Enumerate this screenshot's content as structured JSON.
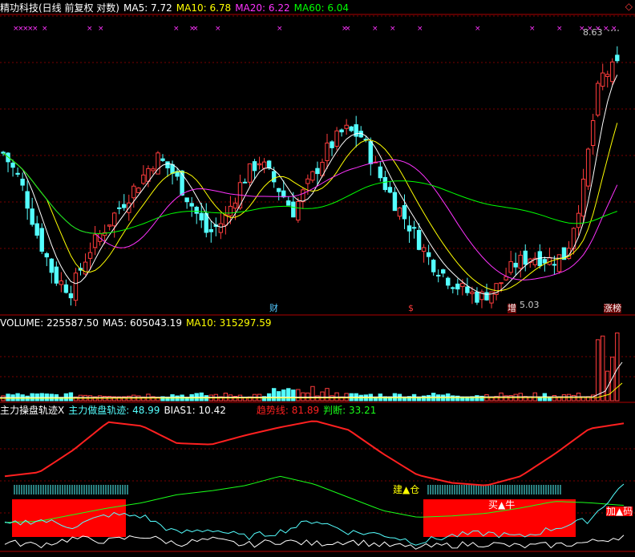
{
  "colors": {
    "up": "#ff3c3c",
    "down": "#54ffff",
    "ma5": "#ffffff",
    "ma10": "#ffff00",
    "ma20": "#ff33ff",
    "ma60": "#00ff00",
    "volume": "#ffffff",
    "trend": "#ff2020",
    "judge": "#19ff19",
    "main": "#54ffff",
    "bias": "#ffffff",
    "red_box": "#ff0000",
    "grid": "#7a0000"
  },
  "header": {
    "stock_name": "精功科技(日线 前复权 对数)",
    "ma5": "MA5: 7.72",
    "ma10": "MA10: 6.78",
    "ma20": "MA20: 6.22",
    "ma60": "MA60: 6.04",
    "corner_icon": "diamond-icon"
  },
  "price_panel": {
    "high_label": "8.63",
    "low_label": "5.03",
    "event_markers": [
      {
        "text": "财",
        "color": "#54c8ff"
      },
      {
        "text": "$",
        "color": "#ff3c3c"
      },
      {
        "text": "增",
        "color": "#ffffff"
      },
      {
        "text": "涨榜",
        "color": "#ffffff"
      }
    ]
  },
  "volume_panel": {
    "volume": "VOLUME: 225587.50",
    "ma5": "MA5: 605043.19",
    "ma10": "MA10: 315297.59"
  },
  "indicator_panel": {
    "title": "主力操盘轨迹X",
    "main_track": "主力做盘轨迹: 48.99",
    "bias1": "BIAS1: 10.42",
    "trend_line": "趋势线: 81.89",
    "judge": "判断: 33.21",
    "signal_build": "建▲仓",
    "signal_buy": "买▲牛",
    "signal_add": "加▲码"
  },
  "chart_data": [
    {
      "type": "candlestick",
      "title": "精功科技(日线 前复权 对数)",
      "scale": "log",
      "series_names": [
        "MA5",
        "MA10",
        "MA20",
        "MA60"
      ],
      "ylim": [
        4.9,
        9.2
      ],
      "y_ticks": [
        8.63,
        5.03
      ],
      "grid": "dotted horizontal",
      "annotations": [
        "8.63",
        "5.03",
        "财",
        "$",
        "增",
        "涨榜"
      ],
      "close_path": [
        6.9,
        6.5,
        5.8,
        5.3,
        5.15,
        5.6,
        5.9,
        6.2,
        6.5,
        6.85,
        6.6,
        6.2,
        5.8,
        6.0,
        6.5,
        6.8,
        6.45,
        6.1,
        6.5,
        6.95,
        7.25,
        7.15,
        6.6,
        6.2,
        5.85,
        5.5,
        5.3,
        5.15,
        5.08,
        5.2,
        5.45,
        5.55,
        5.5,
        5.55,
        6.4,
        8.1,
        8.3
      ]
    },
    {
      "type": "bar",
      "title": "VOLUME",
      "series": [
        {
          "name": "MA5",
          "values": [
            605043.19
          ]
        },
        {
          "name": "MA10",
          "values": [
            315297.59
          ]
        }
      ],
      "last_volume": 225587.5
    },
    {
      "type": "line",
      "title": "主力操盘轨迹X",
      "series": [
        {
          "name": "趋势线",
          "last": 81.89,
          "values": [
            55,
            58,
            75,
            96,
            93,
            80,
            79,
            86,
            92,
            97,
            90,
            72,
            56,
            50,
            48,
            55,
            72,
            91,
            95
          ]
        },
        {
          "name": "判断",
          "last": 33.21,
          "values": [
            20,
            21,
            26,
            31,
            35,
            41,
            44,
            48,
            55,
            49,
            39,
            29,
            24,
            25,
            27,
            31,
            36,
            35,
            33
          ]
        },
        {
          "name": "主力做盘轨迹",
          "last": 48.99,
          "values": [
            18,
            22,
            17,
            26,
            25,
            12,
            15,
            9,
            13,
            22,
            13,
            11,
            5,
            10,
            12,
            9,
            16,
            22,
            49
          ]
        },
        {
          "name": "BIAS1",
          "last": 10.42,
          "values": [
            5,
            3,
            8,
            6,
            10,
            4,
            7,
            3,
            6,
            4,
            6,
            3,
            1,
            3,
            4,
            2,
            3,
            5,
            10
          ]
        }
      ]
    }
  ]
}
